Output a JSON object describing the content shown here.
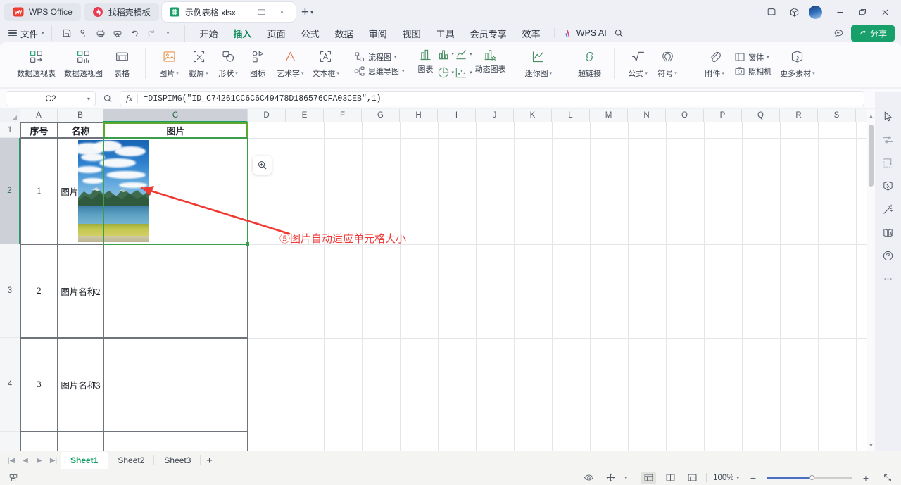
{
  "window": {
    "app_tabs": [
      {
        "label": "WPS Office",
        "icon": "wps-logo-icon"
      },
      {
        "label": "找稻壳模板",
        "icon": "docer-icon"
      }
    ],
    "doc_tab": {
      "label": "示例表格.xlsx",
      "icon": "spreadsheet-icon"
    },
    "new_tab_label": "+",
    "controls": {
      "minimize": "—",
      "maximize": "❐",
      "close": "✕"
    }
  },
  "menu": {
    "file_label": "文件",
    "quick_access": [
      "save-icon",
      "save-as-icon",
      "print-icon",
      "print-preview-icon",
      "undo-icon",
      "redo-icon",
      "customize-icon"
    ],
    "tabs": [
      {
        "label": "开始",
        "active": false
      },
      {
        "label": "插入",
        "active": true
      },
      {
        "label": "页面",
        "active": false
      },
      {
        "label": "公式",
        "active": false
      },
      {
        "label": "数据",
        "active": false
      },
      {
        "label": "审阅",
        "active": false
      },
      {
        "label": "视图",
        "active": false
      },
      {
        "label": "工具",
        "active": false
      },
      {
        "label": "会员专享",
        "active": false
      },
      {
        "label": "效率",
        "active": false
      }
    ],
    "ai_label": "WPS AI",
    "share_label": "分享"
  },
  "ribbon": {
    "group_table": [
      {
        "label": "数据透视表",
        "icon": "pivot-table-icon",
        "caret": false
      },
      {
        "label": "数据透视图",
        "icon": "pivot-chart-icon",
        "caret": false
      },
      {
        "label": "表格",
        "icon": "table-icon",
        "caret": false
      }
    ],
    "group_illustrations": [
      {
        "label": "图片",
        "icon": "picture-icon",
        "caret": true
      },
      {
        "label": "截屏",
        "icon": "screenshot-icon",
        "caret": true
      },
      {
        "label": "形状",
        "icon": "shapes-icon",
        "caret": true
      },
      {
        "label": "图标",
        "icon": "icons-icon",
        "caret": false
      },
      {
        "label": "艺术字",
        "icon": "wordart-icon",
        "caret": true
      },
      {
        "label": "文本框",
        "icon": "textbox-icon",
        "caret": true
      }
    ],
    "group_diagram": [
      {
        "label": "流程图",
        "icon": "flowchart-icon",
        "caret": true
      },
      {
        "label": "思维导图",
        "icon": "mindmap-icon",
        "caret": true
      }
    ],
    "group_charts": [
      {
        "label": "图表",
        "icon": "column-chart-icon",
        "caret": false
      },
      {
        "label": "",
        "icon": "bar-chart-icon",
        "caret": true
      },
      {
        "label": "",
        "icon": "line-chart-icon",
        "caret": true
      },
      {
        "label": "",
        "icon": "pie-chart-icon",
        "caret": true
      },
      {
        "label": "",
        "icon": "scatter-chart-icon",
        "caret": true
      },
      {
        "label": "动态图表",
        "icon": "dynamic-chart-icon",
        "caret": false
      }
    ],
    "group_sparkline": [
      {
        "label": "迷你图",
        "icon": "sparkline-icon",
        "caret": true
      }
    ],
    "group_link": [
      {
        "label": "超链接",
        "icon": "hyperlink-icon",
        "caret": false
      }
    ],
    "group_symbols": [
      {
        "label": "公式",
        "icon": "formula-icon",
        "caret": true
      },
      {
        "label": "符号",
        "icon": "symbol-icon",
        "caret": true
      }
    ],
    "group_media": [
      {
        "label": "附件",
        "icon": "attachment-icon",
        "caret": true
      },
      {
        "label": "窗体",
        "icon": "form-icon",
        "caret": true
      },
      {
        "label": "照相机",
        "icon": "camera-icon",
        "caret": false
      },
      {
        "label": "更多素材",
        "icon": "more-assets-icon",
        "caret": true
      }
    ]
  },
  "formula_bar": {
    "name_box": "C2",
    "formula": "=DISPIMG(\"ID_C74261CC6C6C49478D186576CFA03CEB\",1)",
    "fx_label": "fx"
  },
  "grid": {
    "columns": [
      "A",
      "B",
      "C",
      "D",
      "E",
      "F",
      "G",
      "H",
      "I",
      "J",
      "K",
      "L",
      "M",
      "N",
      "O",
      "P",
      "Q",
      "R",
      "S"
    ],
    "selected_column": "C",
    "rows": [
      "1",
      "2",
      "3",
      "4"
    ],
    "selected_row": "2",
    "headers": {
      "a": "序号",
      "b": "名称",
      "c": "图片"
    },
    "data_rows": [
      {
        "no": "1",
        "name": "图片名称1",
        "picture": "lake-mountain-photo"
      },
      {
        "no": "2",
        "name": "图片名称2",
        "picture": ""
      },
      {
        "no": "3",
        "name": "图片名称3",
        "picture": ""
      }
    ],
    "annotation": "⑤图片自动适应单元格大小",
    "annotation_color": "#ef3a37",
    "selection_color": "#3c9e4a",
    "zoom_chip_icon": "zoom-in-icon"
  },
  "right_rail": {
    "items": [
      {
        "icon": "cursor-select-icon"
      },
      {
        "icon": "settings-sliders-icon"
      },
      {
        "icon": "cell-resize-icon"
      },
      {
        "icon": "paint-format-icon"
      },
      {
        "icon": "magic-wand-icon"
      },
      {
        "icon": "document-search-icon"
      },
      {
        "icon": "help-icon"
      },
      {
        "icon": "more-options-icon"
      }
    ]
  },
  "sheet_bar": {
    "nav": [
      "first-sheet-icon",
      "prev-sheet-icon",
      "next-sheet-icon",
      "last-sheet-icon"
    ],
    "sheets": [
      {
        "label": "Sheet1",
        "active": true
      },
      {
        "label": "Sheet2",
        "active": false
      },
      {
        "label": "Sheet3",
        "active": false
      }
    ],
    "add_label": "+"
  },
  "status_bar": {
    "left_icon": "sheet-status-icon",
    "view_icons": [
      "eye-icon",
      "move-icon"
    ],
    "layout_icons": [
      "normal-view-icon",
      "page-layout-icon",
      "page-break-icon"
    ],
    "zoom_value": "100%",
    "zoom_out": "−",
    "zoom_in": "+",
    "fullscreen_icon": "fullscreen-icon"
  }
}
